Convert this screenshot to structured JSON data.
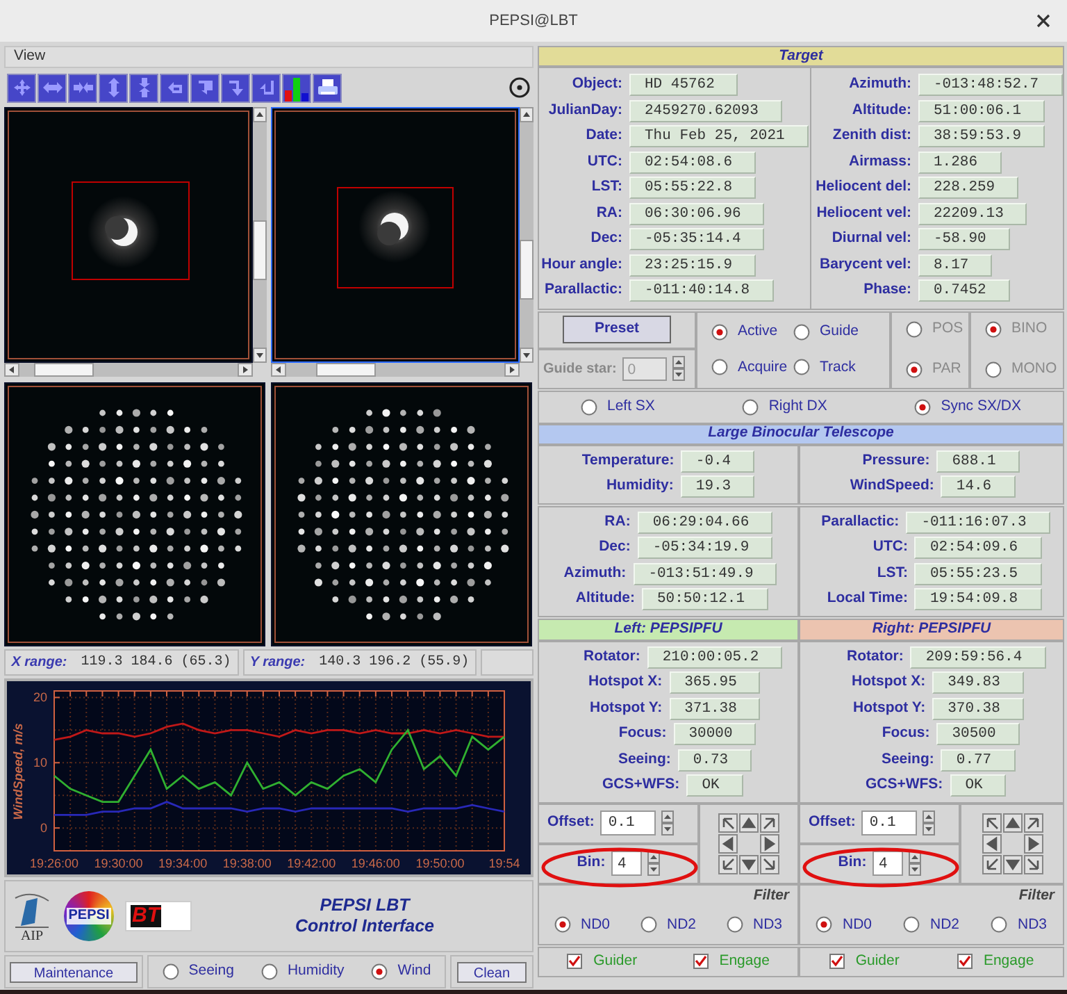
{
  "window": {
    "title": "PEPSI@LBT"
  },
  "menu": [
    "View"
  ],
  "ranges": [
    {
      "label": "X range:",
      "value": "119.3 184.6 (65.3)"
    },
    {
      "label": "Y range:",
      "value": "140.3 196.2 (55.9)"
    }
  ],
  "chart": {
    "chart_data": {
      "type": "line",
      "ylabel": "WindSpeed, m/s",
      "categories": [
        "19:26:00",
        null,
        null,
        null,
        "19:30:00",
        null,
        null,
        null,
        "19:34:00",
        null,
        null,
        null,
        "19:38:00",
        null,
        null,
        null,
        "19:42:00",
        null,
        null,
        null,
        "19:46:00",
        null,
        null,
        null,
        "19:50:00",
        null,
        null,
        null,
        "19:54"
      ],
      "series": [
        {
          "color": "#c01818",
          "values": [
            13.5,
            14,
            15,
            14.5,
            14.5,
            14,
            14.5,
            15.5,
            16,
            15,
            14.5,
            15,
            15,
            14.5,
            14,
            15,
            14.5,
            15,
            15,
            14.5,
            15,
            14.5,
            14.5,
            15,
            14.5,
            15,
            14.5,
            14,
            14
          ]
        },
        {
          "color": "#30b030",
          "values": [
            8,
            6,
            5,
            4,
            4,
            8,
            12,
            6,
            8,
            6,
            7,
            5,
            10,
            6,
            7,
            5,
            7,
            6,
            8,
            9,
            7,
            12,
            15,
            9,
            11,
            8,
            14,
            12,
            14
          ]
        },
        {
          "color": "#2828b8",
          "values": [
            2,
            2,
            2,
            2.5,
            2.5,
            3,
            3,
            4,
            3,
            3,
            3,
            3,
            2.5,
            3,
            3,
            2.5,
            3,
            3,
            3,
            3,
            3,
            3,
            2.5,
            3,
            3,
            3,
            3.5,
            3,
            2.5
          ]
        }
      ],
      "ylim": [
        -3.5,
        21
      ],
      "yticks": [
        0,
        10,
        20
      ],
      "grid": true
    }
  },
  "logos": {
    "aip": "AIP",
    "pepsi": "PEPSI",
    "lbt": "BT"
  },
  "app_title": [
    "PEPSI LBT",
    "Control Interface"
  ],
  "bottom": {
    "maintenance": "Maintenance",
    "plot_options": [
      {
        "label": "Seeing",
        "selected": false
      },
      {
        "label": "Humidity",
        "selected": false
      },
      {
        "label": "Wind",
        "selected": true
      }
    ],
    "clean": "Clean"
  },
  "target": {
    "title": "Target",
    "left": [
      {
        "label": "Object:",
        "value": "HD 45762"
      },
      {
        "label": "JulianDay:",
        "value": "2459270.62093"
      },
      {
        "label": "Date:",
        "value": "Thu Feb 25, 2021"
      },
      {
        "label": "UTC:",
        "value": "02:54:08.6"
      },
      {
        "label": "LST:",
        "value": "05:55:22.8"
      },
      {
        "label": "RA:",
        "value": "06:30:06.96"
      },
      {
        "label": "Dec:",
        "value": "-05:35:14.4"
      },
      {
        "label": "Hour angle:",
        "value": "23:25:15.9"
      },
      {
        "label": "Parallactic:",
        "value": "-011:40:14.8"
      }
    ],
    "right": [
      {
        "label": "Azimuth:",
        "value": "-013:48:52.7"
      },
      {
        "label": "Altitude:",
        "value": "51:00:06.1"
      },
      {
        "label": "Zenith dist:",
        "value": "38:59:53.9"
      },
      {
        "label": "Airmass:",
        "value": "1.286"
      },
      {
        "label": "Heliocent del:",
        "value": "228.259"
      },
      {
        "label": "Heliocent vel:",
        "value": "22209.13"
      },
      {
        "label": "Diurnal vel:",
        "value": "-58.90"
      },
      {
        "label": "Barycent vel:",
        "value": "8.17"
      },
      {
        "label": "Phase:",
        "value": "0.7452"
      }
    ]
  },
  "controls": {
    "preset": "Preset",
    "guide_star": {
      "label": "Guide star:",
      "value": "0",
      "disabled": true
    },
    "modes": [
      {
        "label": "Active",
        "selected": true
      },
      {
        "label": "Guide",
        "selected": false
      },
      {
        "label": "Acquire",
        "selected": false
      },
      {
        "label": "Track",
        "selected": false
      }
    ],
    "angle": {
      "disabled": true,
      "options": [
        {
          "label": "POS",
          "selected": false
        },
        {
          "label": "PAR",
          "selected": true
        }
      ]
    },
    "binocular": {
      "disabled": true,
      "options": [
        {
          "label": "BINO",
          "selected": true
        },
        {
          "label": "MONO",
          "selected": false
        }
      ]
    }
  },
  "sides": [
    {
      "label": "Left SX",
      "selected": false
    },
    {
      "label": "Right DX",
      "selected": false
    },
    {
      "label": "Sync SX/DX",
      "selected": true
    }
  ],
  "lbt": {
    "title": "Large Binocular Telescope",
    "weather_left": [
      {
        "label": "Temperature:",
        "value": "-0.4"
      },
      {
        "label": "Humidity:",
        "value": "19.3"
      }
    ],
    "weather_right": [
      {
        "label": "Pressure:",
        "value": "688.1"
      },
      {
        "label": "WindSpeed:",
        "value": "14.6"
      }
    ],
    "position_left": [
      {
        "label": "RA:",
        "value": "06:29:04.66"
      },
      {
        "label": "Dec:",
        "value": "-05:34:19.9"
      },
      {
        "label": "Azimuth:",
        "value": "-013:51:49.9"
      },
      {
        "label": "Altitude:",
        "value": "50:50:12.1"
      }
    ],
    "position_right": [
      {
        "label": "Parallactic:",
        "value": "-011:16:07.3"
      },
      {
        "label": "UTC:",
        "value": "02:54:09.6"
      },
      {
        "label": "LST:",
        "value": "05:55:23.5"
      },
      {
        "label": "Local Time:",
        "value": "19:54:09.8"
      }
    ]
  },
  "pfu": [
    {
      "title": "Left: PEPSIPFU",
      "color": "#c6eab0",
      "fields": [
        {
          "label": "Rotator:",
          "value": "210:00:05.2"
        },
        {
          "label": "Hotspot X:",
          "value": "365.95"
        },
        {
          "label": "Hotspot Y:",
          "value": "371.38"
        },
        {
          "label": "Focus:",
          "value": "30000"
        },
        {
          "label": "Seeing:",
          "value": "0.73"
        },
        {
          "label": "GCS+WFS:",
          "value": "OK"
        }
      ],
      "offset": {
        "label": "Offset:",
        "value": "0.1"
      },
      "bin": {
        "label": "Bin:",
        "value": "4",
        "highlighted": true
      },
      "filter_title": "Filter",
      "filters": [
        {
          "label": "ND0",
          "selected": true
        },
        {
          "label": "ND2",
          "selected": false
        },
        {
          "label": "ND3",
          "selected": false
        }
      ],
      "checks": [
        {
          "label": "Guider",
          "checked": true
        },
        {
          "label": "Engage",
          "checked": true
        }
      ]
    },
    {
      "title": "Right: PEPSIPFU",
      "color": "#ecc4b0",
      "fields": [
        {
          "label": "Rotator:",
          "value": "209:59:56.4"
        },
        {
          "label": "Hotspot X:",
          "value": "349.83"
        },
        {
          "label": "Hotspot Y:",
          "value": "370.38"
        },
        {
          "label": "Focus:",
          "value": "30500"
        },
        {
          "label": "Seeing:",
          "value": "0.77"
        },
        {
          "label": "GCS+WFS:",
          "value": "OK"
        }
      ],
      "offset": {
        "label": "Offset:",
        "value": "0.1"
      },
      "bin": {
        "label": "Bin:",
        "value": "4",
        "highlighted": true
      },
      "filter_title": "Filter",
      "filters": [
        {
          "label": "ND0",
          "selected": true
        },
        {
          "label": "ND2",
          "selected": false
        },
        {
          "label": "ND3",
          "selected": false
        }
      ],
      "checks": [
        {
          "label": "Guider",
          "checked": true
        },
        {
          "label": "Engage",
          "checked": true
        }
      ]
    }
  ]
}
